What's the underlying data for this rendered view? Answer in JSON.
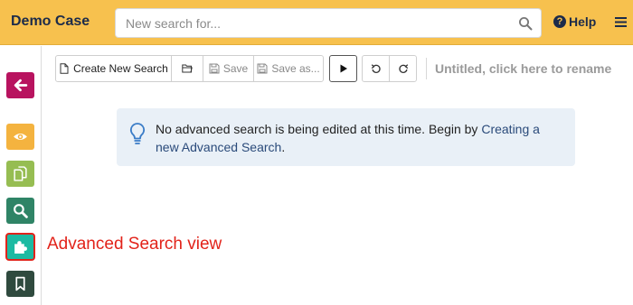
{
  "header": {
    "case_title": "Demo Case",
    "search_placeholder": "New search for...",
    "help_label": "Help"
  },
  "toolbar": {
    "create_new_label": "Create New Search",
    "save_label": "Save",
    "save_as_label": "Save as...",
    "rename_hint": "Untitled, click here to rename"
  },
  "info": {
    "message": "No advanced search is being edited at this time. Begin by ",
    "link_text": "Creating a new Advanced Search",
    "suffix": "."
  },
  "annotation": {
    "label": "Advanced Search view"
  },
  "colors": {
    "header_bg": "#f7c14e",
    "back": "#b8135f",
    "view": "#f4b33f",
    "copy": "#96bd52",
    "search": "#2f8466",
    "advanced": "#1dbaa2",
    "bookmark": "#2f4a3e",
    "annotation": "#e2231a"
  },
  "icons": [
    "search-icon",
    "help-icon",
    "menu-icon",
    "back-arrow-icon",
    "eye-icon",
    "copy-icon",
    "magnifier-icon",
    "puzzle-icon",
    "bookmark-icon",
    "file-icon",
    "folder-icon",
    "save-icon",
    "play-icon",
    "undo-icon",
    "redo-icon",
    "lightbulb-icon"
  ]
}
